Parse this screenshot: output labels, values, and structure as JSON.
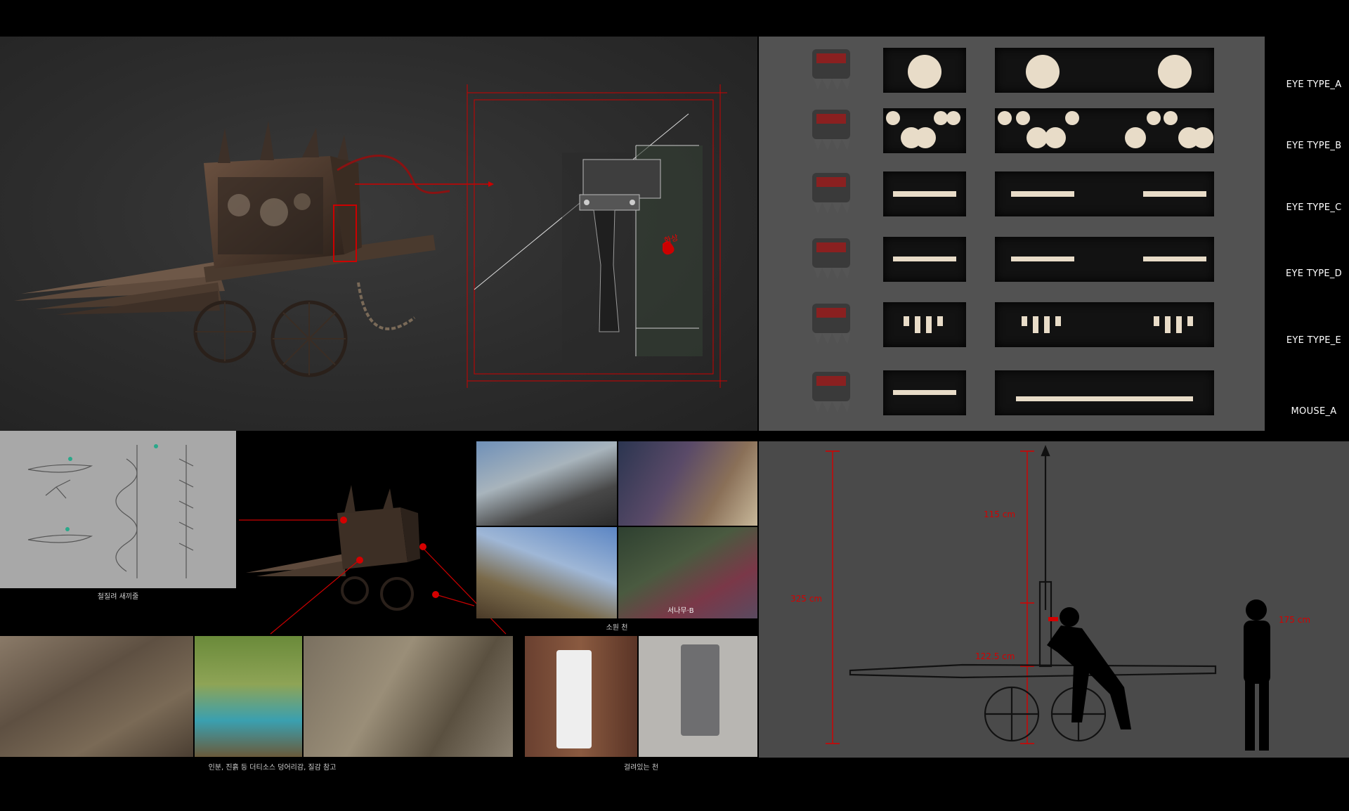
{
  "eye_types": [
    {
      "label": "EYE TYPE_A"
    },
    {
      "label": "EYE TYPE_B"
    },
    {
      "label": "EYE TYPE_C"
    },
    {
      "label": "EYE TYPE_D"
    },
    {
      "label": "EYE TYPE_E"
    },
    {
      "label": "MOUSE_A"
    }
  ],
  "captions": {
    "sketch": "철질려 새끼줄",
    "cloth": "소원 천",
    "mud": "인분, 진흙 등 더티소스 덩어리감, 질감 참고",
    "hanging": "걸려있는 천",
    "photo_overlay": "서나무·B",
    "axe_mark": "화상"
  },
  "dimensions": {
    "total_height": "325 cm",
    "pole_top": "115 cm",
    "cart_height": "122.5 cm",
    "person_height": "175 cm"
  },
  "colors": {
    "accent_red": "#d40000",
    "panel_dark": "#2c2c2c",
    "panel_gray": "#525252"
  }
}
